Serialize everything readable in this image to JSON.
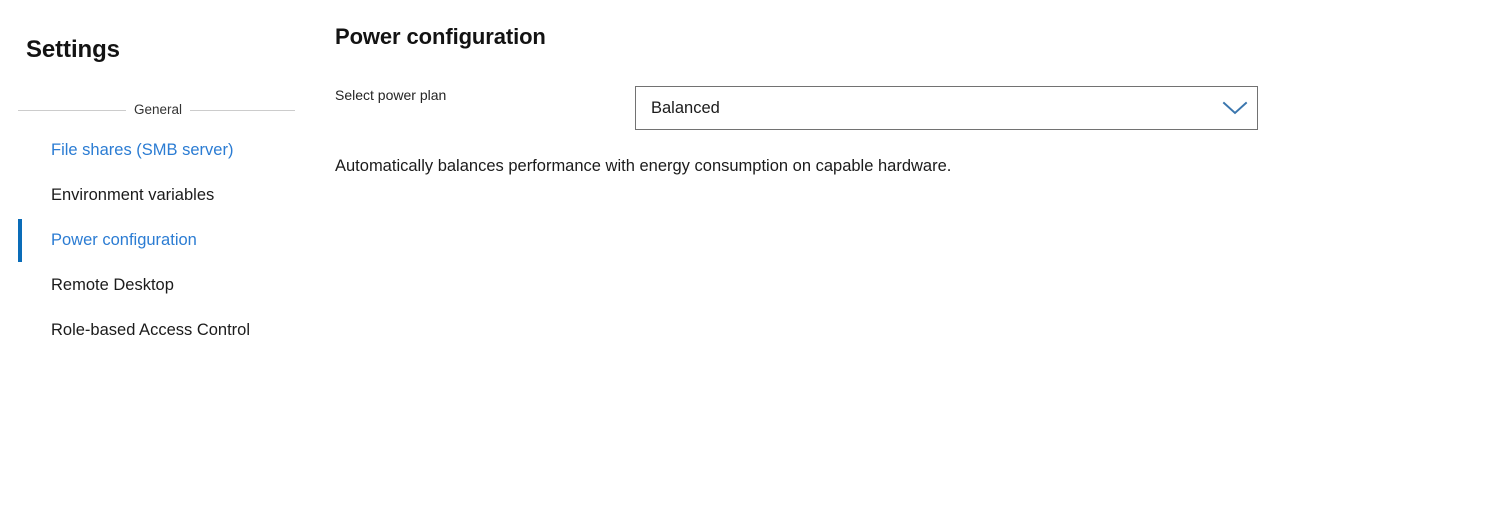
{
  "sidebar": {
    "title": "Settings",
    "group_label": "General",
    "accent_color": "#0a6cb8",
    "link_color": "#2b7cd3",
    "items": [
      {
        "label": "File shares (SMB server)",
        "state": "link",
        "name": "sidebar-item-file-shares"
      },
      {
        "label": "Environment variables",
        "state": "normal",
        "name": "sidebar-item-environment-variables"
      },
      {
        "label": "Power configuration",
        "state": "active",
        "name": "sidebar-item-power-configuration"
      },
      {
        "label": "Remote Desktop",
        "state": "normal",
        "name": "sidebar-item-remote-desktop"
      },
      {
        "label": "Role-based Access Control",
        "state": "normal",
        "name": "sidebar-item-role-based-access-control"
      }
    ]
  },
  "content": {
    "page_title": "Power configuration",
    "field_label": "Select power plan",
    "dropdown": {
      "value": "Balanced",
      "icon": "chevron-down-icon",
      "icon_color": "#3a76ae"
    },
    "description": "Automatically balances performance with energy consumption on capable hardware."
  }
}
